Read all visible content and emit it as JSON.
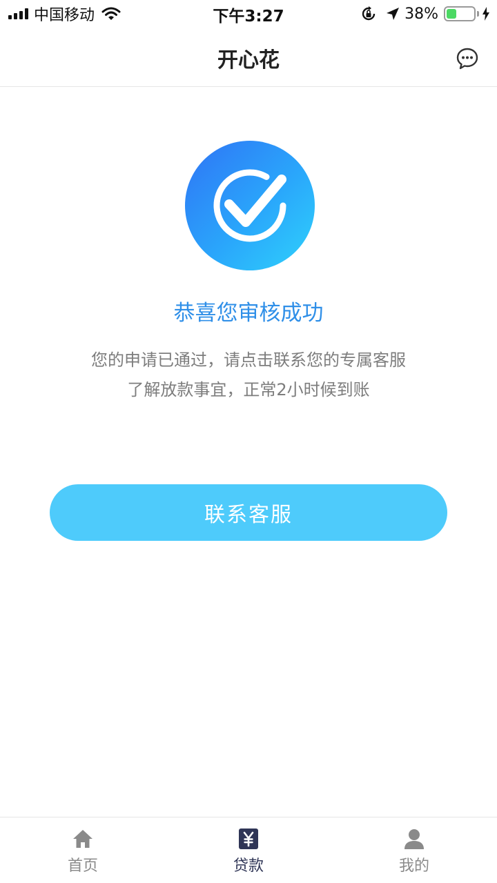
{
  "status_bar": {
    "carrier": "中国移动",
    "time": "下午3:27",
    "battery": "38%",
    "battery_level": 0.38,
    "icons": [
      "signal-icon",
      "wifi-icon",
      "orientation-lock-icon",
      "location-icon",
      "battery-icon",
      "charging-icon"
    ]
  },
  "nav": {
    "title": "开心花",
    "message_icon": "chat-bubble-icon"
  },
  "main": {
    "badge_icon": "check-circle-icon",
    "success_title": "恭喜您审核成功",
    "desc_line1": "您的申请已通过，请点击联系您的专属客服",
    "desc_line2": "了解放款事宜，正常2小时候到账",
    "contact_button": "联系客服"
  },
  "tabs": [
    {
      "label": "首页",
      "icon": "home-icon"
    },
    {
      "label": "贷款",
      "icon": "yen-icon",
      "active": true
    },
    {
      "label": "我的",
      "icon": "user-icon"
    }
  ],
  "colors": {
    "accent": "#2f8fe8",
    "button": "#4ecbfb",
    "badge_start": "#2f74f5",
    "badge_end": "#2fd2fb",
    "battery_fill": "#4cd964",
    "tab_active": "#2f3556",
    "tab_inactive": "#8a8a8a"
  }
}
